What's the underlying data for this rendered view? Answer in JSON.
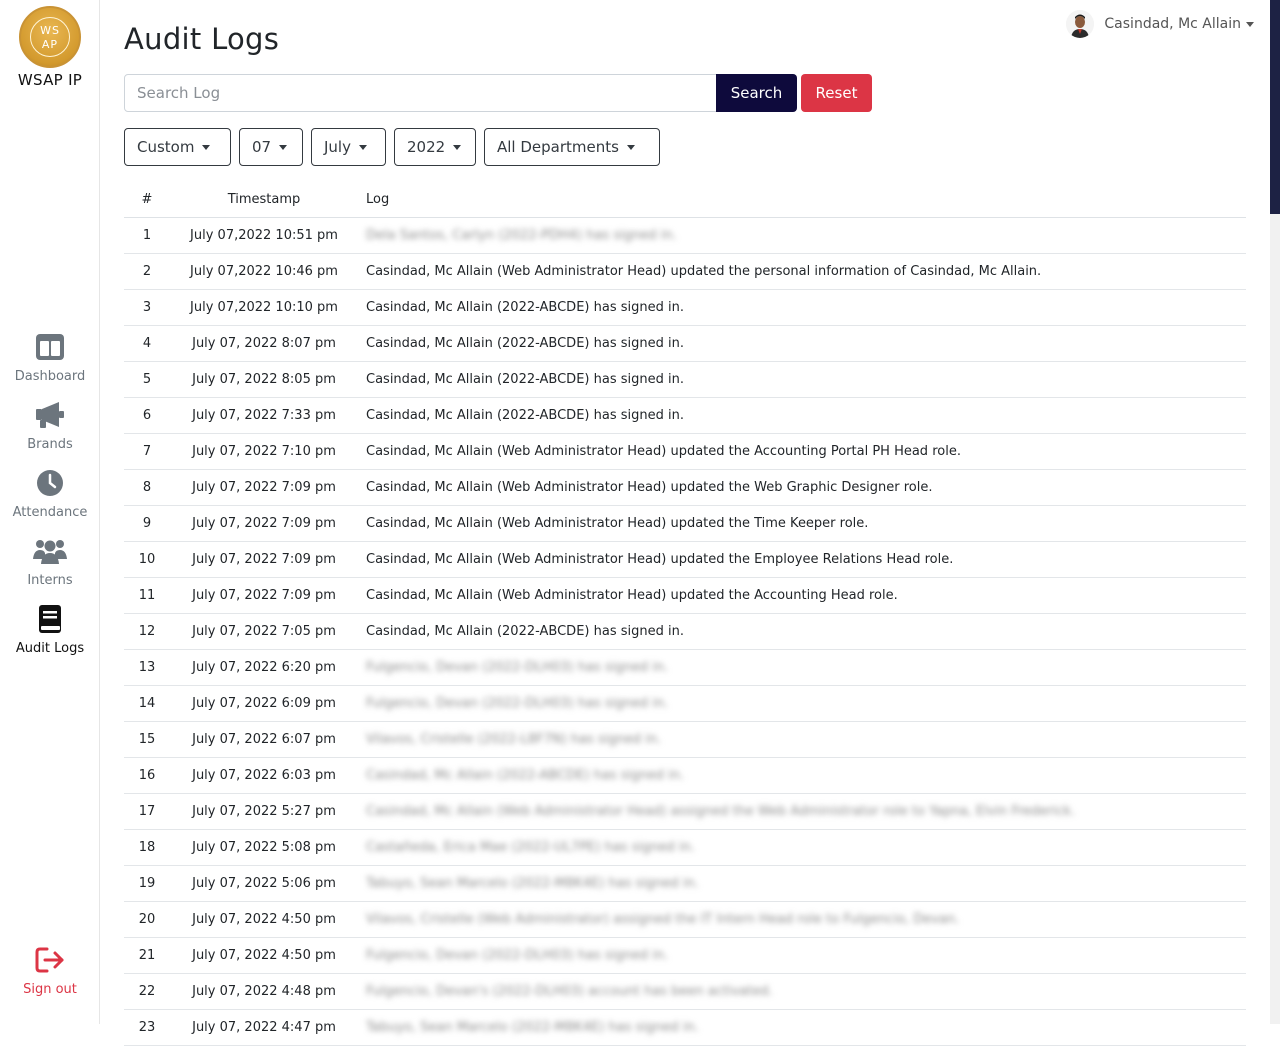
{
  "app": {
    "brand": "WSAP IP",
    "logo_text_1": "WS",
    "logo_text_2": "AP"
  },
  "sidebar": {
    "items": [
      {
        "label": "Dashboard",
        "icon": "dashboard-icon"
      },
      {
        "label": "Brands",
        "icon": "megaphone-icon"
      },
      {
        "label": "Attendance",
        "icon": "clock-icon"
      },
      {
        "label": "Interns",
        "icon": "users-icon"
      },
      {
        "label": "Audit Logs",
        "icon": "book-icon",
        "active": true
      }
    ],
    "signout": {
      "label": "Sign out",
      "icon": "sign-out-icon"
    }
  },
  "header": {
    "title": "Audit Logs",
    "user_name": "Casindad, Mc Allain"
  },
  "search": {
    "placeholder": "Search Log",
    "search_label": "Search",
    "reset_label": "Reset"
  },
  "filters": {
    "range": "Custom",
    "day": "07",
    "month": "July",
    "year": "2022",
    "department": "All Departments"
  },
  "table": {
    "headers": [
      "#",
      "Timestamp",
      "Log"
    ],
    "rows": [
      {
        "num": "1",
        "ts": "July 07,2022 10:51 pm",
        "log": "Dela Santos, Carlyn (2022-PDH4) has signed in.",
        "blur": true
      },
      {
        "num": "2",
        "ts": "July 07,2022 10:46 pm",
        "log": "Casindad, Mc Allain (Web Administrator Head) updated the personal information of Casindad, Mc Allain.",
        "blur": false
      },
      {
        "num": "3",
        "ts": "July 07,2022 10:10 pm",
        "log": "Casindad, Mc Allain (2022-ABCDE) has signed in.",
        "blur": false
      },
      {
        "num": "4",
        "ts": "July 07, 2022 8:07 pm",
        "log": "Casindad, Mc Allain (2022-ABCDE) has signed in.",
        "blur": false
      },
      {
        "num": "5",
        "ts": "July 07, 2022 8:05 pm",
        "log": "Casindad, Mc Allain (2022-ABCDE) has signed in.",
        "blur": false
      },
      {
        "num": "6",
        "ts": "July 07, 2022 7:33 pm",
        "log": "Casindad, Mc Allain (2022-ABCDE) has signed in.",
        "blur": false
      },
      {
        "num": "7",
        "ts": "July 07, 2022 7:10 pm",
        "log": "Casindad, Mc Allain (Web Administrator Head) updated the Accounting Portal PH Head role.",
        "blur": false
      },
      {
        "num": "8",
        "ts": "July 07, 2022 7:09 pm",
        "log": "Casindad, Mc Allain (Web Administrator Head) updated the Web Graphic Designer role.",
        "blur": false
      },
      {
        "num": "9",
        "ts": "July 07, 2022 7:09 pm",
        "log": "Casindad, Mc Allain (Web Administrator Head) updated the Time Keeper role.",
        "blur": false
      },
      {
        "num": "10",
        "ts": "July 07, 2022 7:09 pm",
        "log": "Casindad, Mc Allain (Web Administrator Head) updated the Employee Relations Head role.",
        "blur": false
      },
      {
        "num": "11",
        "ts": "July 07, 2022 7:09 pm",
        "log": "Casindad, Mc Allain (Web Administrator Head) updated the Accounting Head role.",
        "blur": false
      },
      {
        "num": "12",
        "ts": "July 07, 2022 7:05 pm",
        "log": "Casindad, Mc Allain (2022-ABCDE) has signed in.",
        "blur": false
      },
      {
        "num": "13",
        "ts": "July 07, 2022 6:20 pm",
        "log": "Fulgencio, Devan (2022-DLH03) has signed in.",
        "blur": true
      },
      {
        "num": "14",
        "ts": "July 07, 2022 6:09 pm",
        "log": "Fulgencio, Devan (2022-DLH03) has signed in.",
        "blur": true
      },
      {
        "num": "15",
        "ts": "July 07, 2022 6:07 pm",
        "log": "Vilavos, Cristelle (2022-L8F7N) has signed in.",
        "blur": true
      },
      {
        "num": "16",
        "ts": "July 07, 2022 6:03 pm",
        "log": "Casindad, Mc Allain (2022-ABCDE) has signed in.",
        "blur": true
      },
      {
        "num": "17",
        "ts": "July 07, 2022 5:27 pm",
        "log": "Casindad, Mc Allain (Web Administrator Head) assigned the Web Administrator role to Yapna, Elvin Frederick.",
        "blur": true
      },
      {
        "num": "18",
        "ts": "July 07, 2022 5:08 pm",
        "log": "Castañeda, Erica Mae (2022-UL7PE) has signed in.",
        "blur": true
      },
      {
        "num": "19",
        "ts": "July 07, 2022 5:06 pm",
        "log": "Tabuyo, Sean Marcelo (2022-M8K4E) has signed in.",
        "blur": true
      },
      {
        "num": "20",
        "ts": "July 07, 2022 4:50 pm",
        "log": "Vilavos, Cristelle (Web Administrator) assigned the IT Intern Head role to Fulgencio, Devan.",
        "blur": true
      },
      {
        "num": "21",
        "ts": "July 07, 2022 4:50 pm",
        "log": "Fulgencio, Devan (2022-DLH03) has signed in.",
        "blur": true
      },
      {
        "num": "22",
        "ts": "July 07, 2022 4:48 pm",
        "log": "Fulgencio, Devan's (2022-DLH03) account has been activated.",
        "blur": true
      },
      {
        "num": "23",
        "ts": "July 07, 2022 4:47 pm",
        "log": "Tabuyo, Sean Marcelo (2022-M8K4E) has signed in.",
        "blur": true
      }
    ]
  },
  "colors": {
    "search_button": "#0e0a3c",
    "reset_button": "#dc3545",
    "signout": "#dc3545",
    "logo": "#d39a2e"
  }
}
